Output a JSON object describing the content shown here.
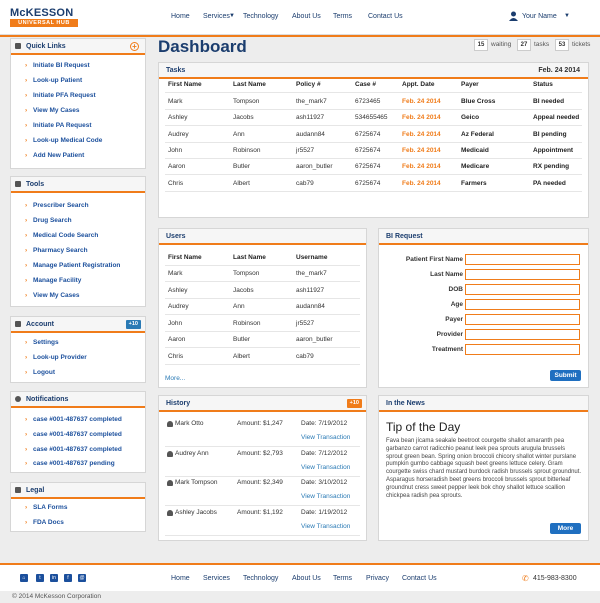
{
  "brand": {
    "line1": "McKESSON",
    "line2": "UNIVERSAL HUB"
  },
  "nav": [
    "Home",
    "Services",
    "Technology",
    "About Us",
    "Terms",
    "Contact Us"
  ],
  "user": {
    "name": "Your Name"
  },
  "page": {
    "title": "Dashboard",
    "counters": [
      {
        "value": "15",
        "label": "waiting"
      },
      {
        "value": "27",
        "label": "tasks"
      },
      {
        "value": "53",
        "label": "tickets"
      }
    ]
  },
  "quick_links": {
    "title": "Quick Links",
    "items": [
      "Initiate BI Request",
      "Look-up Patient",
      "Initiate PFA Request",
      "View My Cases",
      "Initiate PA Request",
      "Look-up Medical Code",
      "Add New Patient"
    ]
  },
  "tools": {
    "title": "Tools",
    "items": [
      "Prescriber Search",
      "Drug Search",
      "Medical Code Search",
      "Pharmacy Search",
      "Manage Patient Registration",
      "Manage Facility",
      "View My Cases"
    ]
  },
  "account": {
    "title": "Account",
    "badge": "+10",
    "items": [
      "Settings",
      "Look-up Provider",
      "Logout"
    ]
  },
  "notifications": {
    "title": "Notifications",
    "items": [
      "case #001-487637 completed",
      "case #001-487637 completed",
      "case #001-487637 completed",
      "case #001-487637 pending"
    ]
  },
  "legal": {
    "title": "Legal",
    "items": [
      "SLA Forms",
      "FDA Docs"
    ]
  },
  "tasks": {
    "title": "Tasks",
    "date": "Feb. 24 2014",
    "headers": [
      "First Name",
      "Last Name",
      "Policy #",
      "Case #",
      "Appt. Date",
      "Payer",
      "Status"
    ],
    "rows": [
      [
        "Mark",
        "Tompson",
        "the_mark7",
        "6723465",
        "Feb. 24 2014",
        "Blue Cross",
        "BI needed"
      ],
      [
        "Ashley",
        "Jacobs",
        "ash11927",
        "534655465",
        "Feb. 24 2014",
        "Geico",
        "Appeal needed"
      ],
      [
        "Audrey",
        "Ann",
        "audann84",
        "6725674",
        "Feb. 24 2014",
        "Az Federal",
        "BI pending"
      ],
      [
        "John",
        "Robinson",
        "jr5527",
        "6725674",
        "Feb. 24 2014",
        "Medicaid",
        "Appointment"
      ],
      [
        "Aaron",
        "Butler",
        "aaron_butler",
        "6725674",
        "Feb. 24 2014",
        "Medicare",
        "RX pending"
      ],
      [
        "Chris",
        "Albert",
        "cab79",
        "6725674",
        "Feb. 24 2014",
        "Farmers",
        "PA needed"
      ]
    ]
  },
  "users": {
    "title": "Users",
    "headers": [
      "First Name",
      "Last Name",
      "Username"
    ],
    "rows": [
      [
        "Mark",
        "Tompson",
        "the_mark7"
      ],
      [
        "Ashley",
        "Jacobs",
        "ash11927"
      ],
      [
        "Audrey",
        "Ann",
        "audann84"
      ],
      [
        "John",
        "Robinson",
        "jr5527"
      ],
      [
        "Aaron",
        "Butler",
        "aaron_butler"
      ],
      [
        "Chris",
        "Albert",
        "cab79"
      ]
    ],
    "more": "More..."
  },
  "bi_request": {
    "title": "BI Request",
    "fields": [
      "Patient First Name",
      "Last Name",
      "DOB",
      "Age",
      "Payer",
      "Provider",
      "Treatment"
    ],
    "submit": "Submit"
  },
  "history": {
    "title": "History",
    "badge": "+10",
    "rows": [
      {
        "name": "Mark Otto",
        "amount": "Amount: $1,247",
        "date": "Date: 7/19/2012",
        "action": "View Transaction"
      },
      {
        "name": "Audrey Ann",
        "amount": "Amount: $2,793",
        "date": "Date: 7/12/2012",
        "action": "View Transaction"
      },
      {
        "name": "Mark Tompson",
        "amount": "Amount: $2,349",
        "date": "Date: 3/10/2012",
        "action": "View Transaction"
      },
      {
        "name": "Ashley Jacobs",
        "amount": "Amount: $1,192",
        "date": "Date: 1/19/2012",
        "action": "View Transaction"
      }
    ]
  },
  "news": {
    "title": "In the News",
    "headline": "Tip of the Day",
    "body": "Fava bean jícama seakale beetroot courgette shallot amaranth pea garbanzo carrot radicchio peanut leek pea sprouts arugula brussels sprout green bean. Spring onion broccoli chicory shallot winter purslane pumpkin gumbo cabbage squash beet greens lettuce celery. Gram courgette swiss chard mustard burdock radish brussels sprout groundnut. Asparagus horseradish beet greens broccoli brussels sprout bitterleaf groundnut cress sweet pepper leek bok choy shallot lettuce scallion chickpea radish pea sprouts.",
    "more": "More"
  },
  "footer": {
    "nav": [
      "Home",
      "Services",
      "Technology",
      "About Us",
      "Terms",
      "Privacy",
      "Contact Us"
    ],
    "phone": "415-983-8300",
    "copyright": "© 2014 McKesson Corporation",
    "social": [
      "t",
      "tw",
      "in",
      "f",
      "@"
    ]
  },
  "colors": {
    "accent": "#f07c1a",
    "brand": "#1b3d6e",
    "link": "#2a7ab5",
    "button": "#1f6fc0"
  }
}
